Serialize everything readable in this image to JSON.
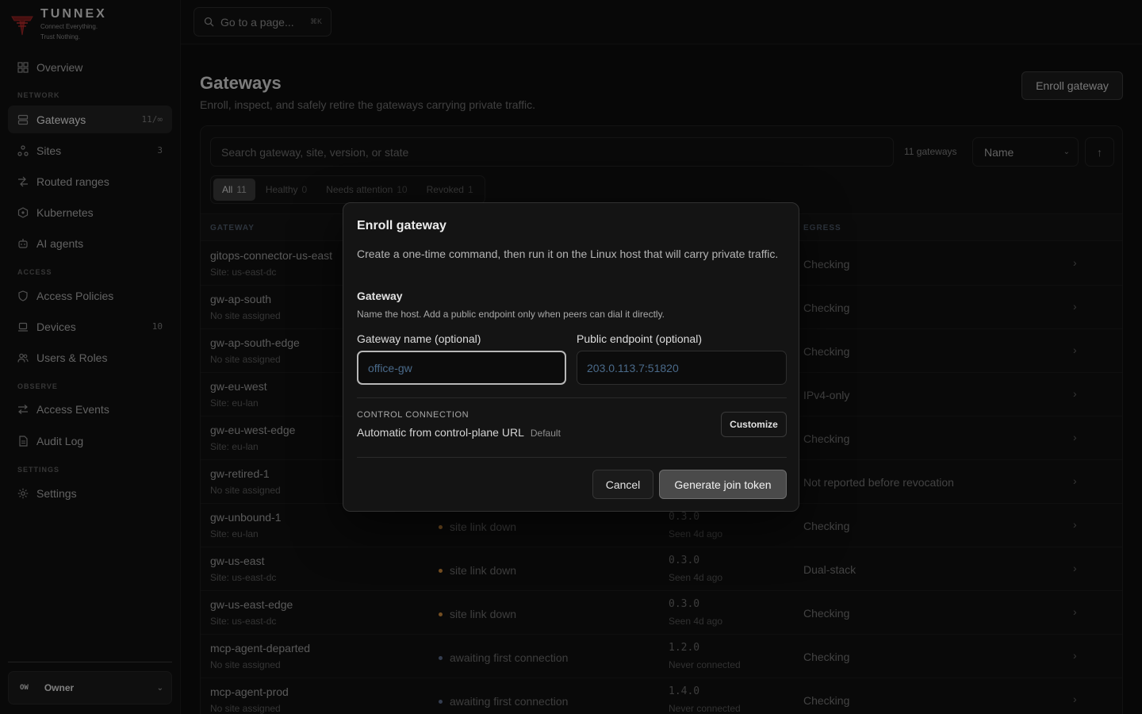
{
  "brand": {
    "name": "TUNNEX",
    "tagline_1": "Connect Everything.",
    "tagline_2": "Trust Nothing."
  },
  "sidebar": {
    "overview": "Overview",
    "section_network": "NETWORK",
    "gateways": "Gateways",
    "gateways_count": "11/∞",
    "sites": "Sites",
    "sites_count": "3",
    "routed_ranges": "Routed ranges",
    "kubernetes": "Kubernetes",
    "ai_agents": "AI agents",
    "section_access": "ACCESS",
    "access_policies": "Access Policies",
    "devices": "Devices",
    "devices_count": "10",
    "users_roles": "Users & Roles",
    "section_observe": "OBSERVE",
    "access_events": "Access Events",
    "audit_log": "Audit Log",
    "section_settings": "SETTINGS",
    "settings": "Settings",
    "owner_initials": "OW",
    "owner_label": "Owner"
  },
  "topbar": {
    "goto_label": "Go to a page...",
    "goto_shortcut": "⌘K"
  },
  "page": {
    "title": "Gateways",
    "subtitle": "Enroll, inspect, and safely retire the gateways carrying private traffic.",
    "enroll_button": "Enroll gateway"
  },
  "toolbar": {
    "search_placeholder": "Search gateway, site, version, or state",
    "gateway_count": "11 gateways",
    "sort_value": "Name"
  },
  "filters": {
    "all": "All",
    "all_n": "11",
    "healthy": "Healthy",
    "healthy_n": "0",
    "attention": "Needs attention",
    "attention_n": "10",
    "revoked": "Revoked",
    "revoked_n": "1"
  },
  "table": {
    "col_gateway": "GATEWAY",
    "col_egress": "EGRESS",
    "rows": [
      {
        "name": "gitops-connector-us-east",
        "site": "Site: us-east-dc",
        "status": "",
        "version": "",
        "seen": "",
        "egress": "Checking"
      },
      {
        "name": "gw-ap-south",
        "site": "No site assigned",
        "status": "",
        "version": "",
        "seen": "",
        "egress": "Checking"
      },
      {
        "name": "gw-ap-south-edge",
        "site": "No site assigned",
        "status": "",
        "version": "",
        "seen": "",
        "egress": "Checking"
      },
      {
        "name": "gw-eu-west",
        "site": "Site: eu-lan",
        "status": "",
        "version": "",
        "seen": "",
        "egress": "IPv4-only"
      },
      {
        "name": "gw-eu-west-edge",
        "site": "Site: eu-lan",
        "status": "",
        "version": "",
        "seen": "",
        "egress": "Checking"
      },
      {
        "name": "gw-retired-1",
        "site": "No site assigned",
        "status": "",
        "version": "",
        "seen": "",
        "egress": "Not reported before revocation"
      },
      {
        "name": "gw-unbound-1",
        "site": "Site: eu-lan",
        "status": "site link down",
        "version": "0.3.0",
        "seen": "Seen 4d ago",
        "egress": "Checking"
      },
      {
        "name": "gw-us-east",
        "site": "Site: us-east-dc",
        "status": "site link down",
        "version": "0.3.0",
        "seen": "Seen 4d ago",
        "egress": "Dual-stack"
      },
      {
        "name": "gw-us-east-edge",
        "site": "Site: us-east-dc",
        "status": "site link down",
        "version": "0.3.0",
        "seen": "Seen 4d ago",
        "egress": "Checking"
      },
      {
        "name": "mcp-agent-departed",
        "site": "No site assigned",
        "status": "awaiting first connection",
        "version": "1.2.0",
        "seen": "Never connected",
        "egress": "Checking"
      },
      {
        "name": "mcp-agent-prod",
        "site": "No site assigned",
        "status": "awaiting first connection",
        "version": "1.4.0",
        "seen": "Never connected",
        "egress": "Checking"
      }
    ]
  },
  "modal": {
    "title": "Enroll gateway",
    "description": "Create a one-time command, then run it on the Linux host that will carry private traffic.",
    "section_title": "Gateway",
    "section_sub": "Name the host. Add a public endpoint only when peers can dial it directly.",
    "name_label": "Gateway name (optional)",
    "name_placeholder": "office-gw",
    "name_value": "",
    "endpoint_label": "Public endpoint (optional)",
    "endpoint_placeholder": "203.0.113.7:51820",
    "endpoint_value": "",
    "control_title": "CONTROL CONNECTION",
    "control_value": "Automatic from control-plane URL",
    "control_default": "Default",
    "customize": "Customize",
    "cancel": "Cancel",
    "generate": "Generate join token"
  },
  "colors": {
    "status_warn": "#c8873a",
    "status_pending": "#5a6a8a",
    "accent": "#b8b8b8"
  }
}
